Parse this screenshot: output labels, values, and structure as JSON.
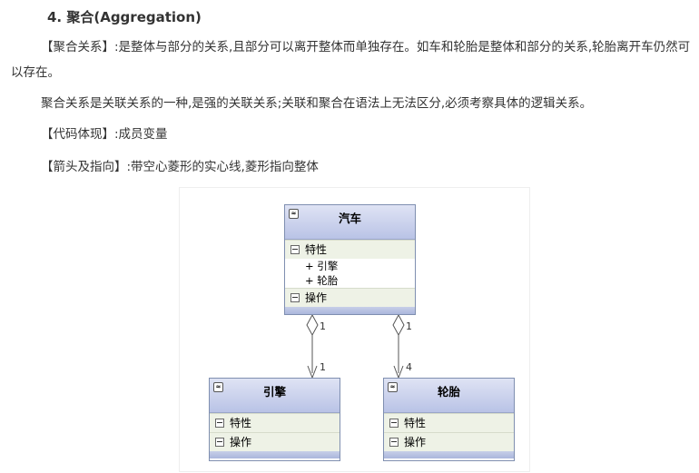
{
  "heading": "4. 聚合(Aggregation)",
  "paragraphs": {
    "p1": "【聚合关系】:是整体与部分的关系,且部分可以离开整体而单独存在。如车和轮胎是整体和部分的关系,轮胎离开车仍然可以存在。",
    "p2": "聚合关系是关联关系的一种,是强的关联关系;关联和聚合在语法上无法区分,必须考察具体的逻辑关系。",
    "p3": "【代码体现】:成员变量",
    "p4": "【箭头及指向】:带空心菱形的实心线,菱形指向整体"
  },
  "diagram": {
    "car": {
      "name": "汽车",
      "attributes_label": "特性",
      "attributes": [
        "+ 引擎",
        "+ 轮胎"
      ],
      "operations_label": "操作"
    },
    "engine": {
      "name": "引擎",
      "attributes_label": "特性",
      "operations_label": "操作"
    },
    "tire": {
      "name": "轮胎",
      "attributes_label": "特性",
      "operations_label": "操作"
    },
    "multiplicity": {
      "car_engine_whole": "1",
      "car_engine_part": "1",
      "car_tire_whole": "1",
      "car_tire_part": "4"
    },
    "collapse_glyph": "≈"
  }
}
